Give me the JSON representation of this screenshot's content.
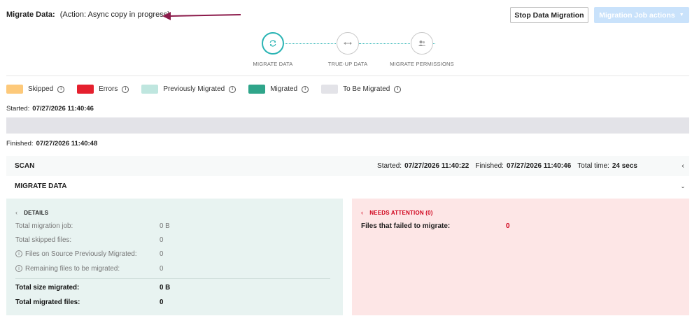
{
  "header": {
    "title_label": "Migrate Data:",
    "action_text": "(Action: Async copy in progress)",
    "stop_button": "Stop Data Migration",
    "actions_button": "Migration Job actions",
    "arrow_color": "#8b1a4a"
  },
  "steps": [
    {
      "label": "MIGRATE DATA",
      "icon": "refresh-icon",
      "active": true
    },
    {
      "label": "TRUE-UP DATA",
      "icon": "swap-icon",
      "active": false
    },
    {
      "label": "MIGRATE PERMISSIONS",
      "icon": "users-icon",
      "active": false
    }
  ],
  "legend": [
    {
      "label": "Skipped",
      "color": "#fdc97a"
    },
    {
      "label": "Errors",
      "color": "#e5202e"
    },
    {
      "label": "Previously Migrated",
      "color": "#bfe6df"
    },
    {
      "label": "Migrated",
      "color": "#2fa58a"
    },
    {
      "label": "To Be Migrated",
      "color": "#e3e3e8"
    }
  ],
  "progress": {
    "started_label": "Started:",
    "started_value": "07/27/2026 11:40:46",
    "finished_label": "Finished:",
    "finished_value": "07/27/2026 11:40:48"
  },
  "scan": {
    "name": "SCAN",
    "started_label": "Started:",
    "started_value": "07/27/2026 11:40:22",
    "finished_label": "Finished:",
    "finished_value": "07/27/2026 11:40:46",
    "total_label": "Total time:",
    "total_value": "24 secs"
  },
  "migrate_section": {
    "name": "MIGRATE DATA"
  },
  "details": {
    "title": "DETAILS",
    "rows": [
      {
        "label": "Total migration job:",
        "value": "0 B"
      },
      {
        "label": "Total skipped files:",
        "value": "0"
      },
      {
        "label": "Files on Source Previously Migrated:",
        "value": "0"
      },
      {
        "label": "Remaining files to be migrated:",
        "value": "0"
      }
    ],
    "totals": [
      {
        "label": "Total size migrated:",
        "value": "0 B"
      },
      {
        "label": "Total migrated files:",
        "value": "0"
      }
    ]
  },
  "attention": {
    "title": "NEEDS ATTENTION (0)",
    "failed_label": "Files that failed to migrate:",
    "failed_value": "0"
  }
}
